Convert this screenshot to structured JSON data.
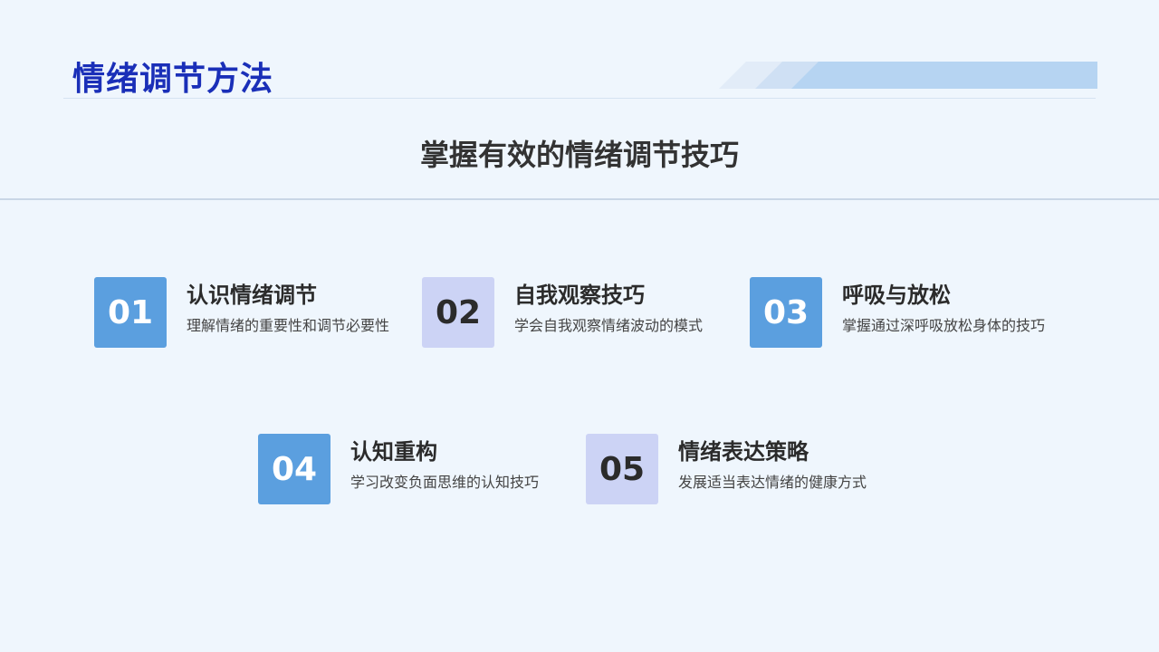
{
  "header": {
    "title": "情绪调节方法"
  },
  "subtitle": "掌握有效的情绪调节技巧",
  "items": [
    {
      "number": "01",
      "title": "认识情绪调节",
      "desc": "理解情绪的重要性和调节必要性"
    },
    {
      "number": "02",
      "title": "自我观察技巧",
      "desc": "学会自我观察情绪波动的模式"
    },
    {
      "number": "03",
      "title": "呼吸与放松",
      "desc": "掌握通过深呼吸放松身体的技巧"
    },
    {
      "number": "04",
      "title": "认知重构",
      "desc": "学习改变负面思维的认知技巧"
    },
    {
      "number": "05",
      "title": "情绪表达策略",
      "desc": "发展适当表达情绪的健康方式"
    }
  ],
  "colors": {
    "title": "#1a2fb8",
    "badge_blue": "#5b9fdf",
    "badge_lavender": "#ccd3f5",
    "background": "#eff6fd"
  }
}
